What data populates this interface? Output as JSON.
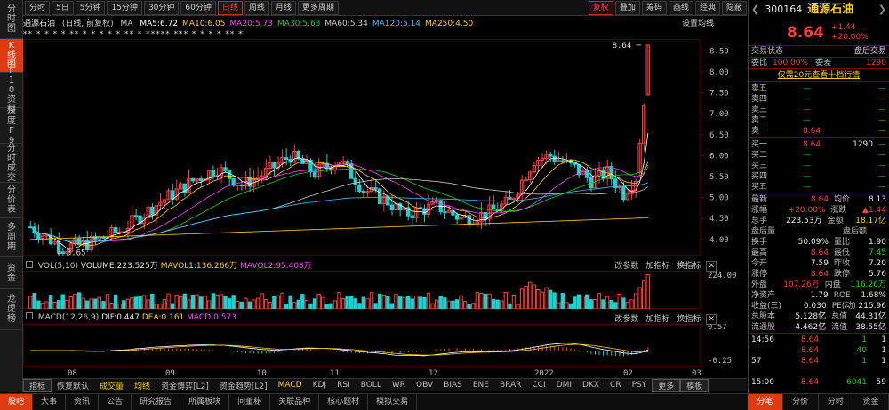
{
  "toolbar": {
    "periods": [
      "分时",
      "5日",
      "5分钟",
      "15分钟",
      "30分钟",
      "60分钟",
      "日线",
      "周线",
      "月线",
      "更多周期"
    ],
    "active_period": "日线",
    "right": [
      "复权",
      "叠加",
      "筹码",
      "画线",
      "经典",
      "隐蔽"
    ]
  },
  "left_tabs": [
    "分时图",
    "K线图",
    "F10资料",
    "深度F9",
    "分时成交",
    "分价表",
    "多周期",
    "资金",
    "龙虎榜"
  ],
  "ma_header": {
    "name": "通源石油",
    "mode": "(日线, 前复权)",
    "ma_label": "MA",
    "items": [
      {
        "label": "MA5:6.72",
        "color": "#ffffff"
      },
      {
        "label": "MA10:6.05",
        "color": "#ffd200"
      },
      {
        "label": "MA20:5.73",
        "color": "#ff40ff"
      },
      {
        "label": "MA30:5.63",
        "color": "#19d219"
      },
      {
        "label": "MA60:5.34",
        "color": "#c8c8c8"
      },
      {
        "label": "MA120:5.14",
        "color": "#40c0ff"
      },
      {
        "label": "MA250:4.50",
        "color": "#ffd200"
      }
    ],
    "setting": "设置均线"
  },
  "stars": "** *        *    *      *      **     *    *     *  *    *   **    *       *****  ***  *  *    *   *   **   *",
  "chart_data": {
    "type": "candlestick",
    "y_ticks": [
      "8.50",
      "8.00",
      "7.50",
      "7.00",
      "6.50",
      "6.00",
      "5.50",
      "5.00",
      "4.50",
      "4.00"
    ],
    "y_range": [
      3.7,
      8.7
    ],
    "x_labels": [
      "08",
      "09",
      "10",
      "11",
      "12",
      "2022",
      "02",
      "03"
    ],
    "high_label": "8.64",
    "low_label": "3.65",
    "candles_note": "approx daily candles"
  },
  "vol_header": {
    "vol": "VOL(5,10)",
    "volume": "VOLUME:223.525万",
    "mavol1": "MAVOL1:136.266万",
    "mavol2": "MAVOL2:95.408万",
    "actions": [
      "改参数",
      "加指标",
      "换指标"
    ],
    "ymax": "224.00"
  },
  "macd_header": {
    "macd": "MACD(12,26,9)",
    "dif": "DIF:0.447",
    "dea": "DEA:0.161",
    "val": "MACD:0.573",
    "actions": [
      "改参数",
      "加指标",
      "换指标"
    ],
    "ytop": "0.57",
    "ybot": "-0.25"
  },
  "indicator_tabs": [
    "指标",
    "恢复默认",
    "成交量",
    "均线",
    "资金博弈[L2]",
    "资金趋势[L2]",
    "MACD",
    "KDJ",
    "RSI",
    "BOLL",
    "WR",
    "OBV",
    "BIAS",
    "ENE",
    "BRAR",
    "CCI",
    "DMI",
    "DKX",
    "CR",
    "PSY",
    "更多",
    "模板"
  ],
  "bottom_tabs": [
    "股吧",
    "大事",
    "资讯",
    "公告",
    "研究报告",
    "所属板块",
    "问董秘",
    "关联品种",
    "核心题材",
    "模拟交易"
  ],
  "quote": {
    "code": "300164",
    "name": "通源石油",
    "price": "8.64",
    "change": "+1.44",
    "change_pct": "+20.00%",
    "status_label": "交易状态",
    "status_value": "盘后交易",
    "weibi_label": "委比",
    "weibi": "100.00%",
    "weicha_label": "委差",
    "weicha": "1290",
    "promo": "仅需20元查看十档行情",
    "asks": [
      {
        "label": "卖五",
        "price": "—",
        "vol": ""
      },
      {
        "label": "卖四",
        "price": "—",
        "vol": ""
      },
      {
        "label": "卖三",
        "price": "—",
        "vol": ""
      },
      {
        "label": "卖二",
        "price": "—",
        "vol": ""
      },
      {
        "label": "卖一",
        "price": "8.64",
        "vol": ""
      }
    ],
    "bids": [
      {
        "label": "买一",
        "price": "8.64",
        "vol": "1290"
      },
      {
        "label": "买二",
        "price": "—",
        "vol": ""
      },
      {
        "label": "买三",
        "price": "—",
        "vol": ""
      },
      {
        "label": "买四",
        "price": "—",
        "vol": ""
      },
      {
        "label": "买五",
        "price": "—",
        "vol": ""
      }
    ],
    "stats": [
      [
        "最新",
        "8.64",
        "均价",
        "8.13"
      ],
      [
        "涨幅",
        "+20.00%",
        "涨跌",
        "▲1.44"
      ],
      [
        "总手",
        "223.53万",
        "金额",
        "18.17亿"
      ],
      [
        "盘后量",
        "",
        "盘后额",
        ""
      ],
      [
        "换手",
        "50.09%",
        "量比",
        "1.90"
      ],
      [
        "最高",
        "8.64",
        "最低",
        "7.45"
      ],
      [
        "今开",
        "7.59",
        "昨收",
        "7.20"
      ],
      [
        "涨停",
        "8.64",
        "跌停",
        "5.76"
      ],
      [
        "外盘",
        "107.26万",
        "内盘",
        "116.26万"
      ],
      [
        "净资产",
        "1.79",
        "ROE",
        "1.68%"
      ],
      [
        "收益(三)",
        "0.030",
        "PE(动)",
        "215.96"
      ],
      [
        "总股本",
        "5.128亿",
        "总值",
        "44.31亿"
      ],
      [
        "流通股",
        "4.462亿",
        "流值",
        "38.55亿"
      ]
    ],
    "ticks": [
      [
        "14:56",
        "8.64",
        "1",
        "1"
      ],
      [
        "",
        "8.64",
        "40",
        "1"
      ],
      [
        "57",
        "8.64",
        "1",
        "1"
      ],
      [
        "",
        "",
        "",
        ""
      ],
      [
        "15:00",
        "8.64",
        "6041",
        "59"
      ]
    ],
    "bottom_tabs": [
      "分笔",
      "分价",
      "分时",
      "资金"
    ]
  }
}
